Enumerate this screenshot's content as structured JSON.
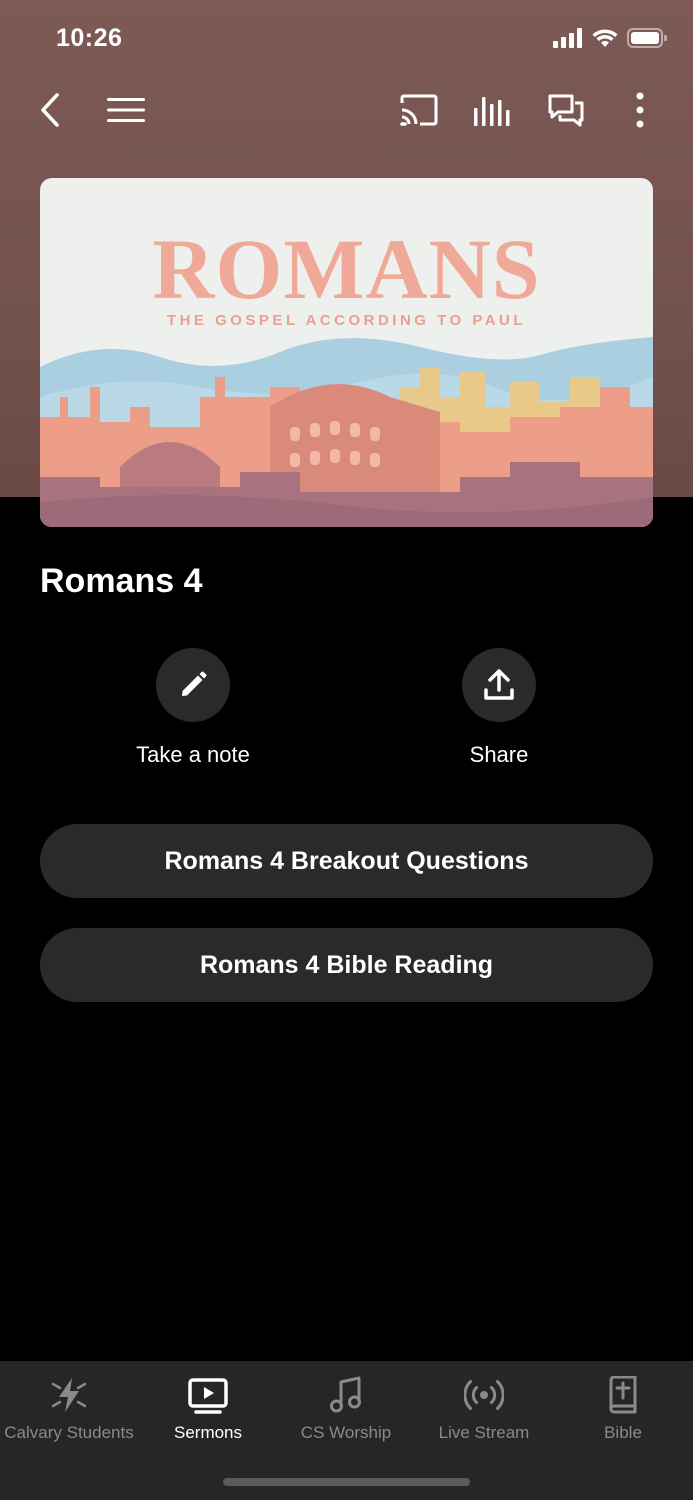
{
  "status_bar": {
    "time": "10:26"
  },
  "artwork": {
    "title": "ROMANS",
    "subtitle": "THE GOSPEL ACCORDING TO PAUL"
  },
  "sermon": {
    "title": "Romans 4"
  },
  "actions": {
    "note_label": "Take a note",
    "share_label": "Share"
  },
  "resources": [
    {
      "label": "Romans 4 Breakout Questions"
    },
    {
      "label": "Romans 4 Bible Reading"
    }
  ],
  "tabs": [
    {
      "label": "Calvary Students",
      "icon": "bolt-icon"
    },
    {
      "label": "Sermons",
      "icon": "video-icon",
      "active": true
    },
    {
      "label": "CS Worship",
      "icon": "music-note-icon"
    },
    {
      "label": "Live Stream",
      "icon": "broadcast-icon"
    },
    {
      "label": "Bible",
      "icon": "bible-icon"
    }
  ],
  "colors": {
    "header_bg": "#7d5a55",
    "button_bg": "#2a2a2a",
    "tabbar_bg": "#262626",
    "art_accent": "#f0a898"
  }
}
